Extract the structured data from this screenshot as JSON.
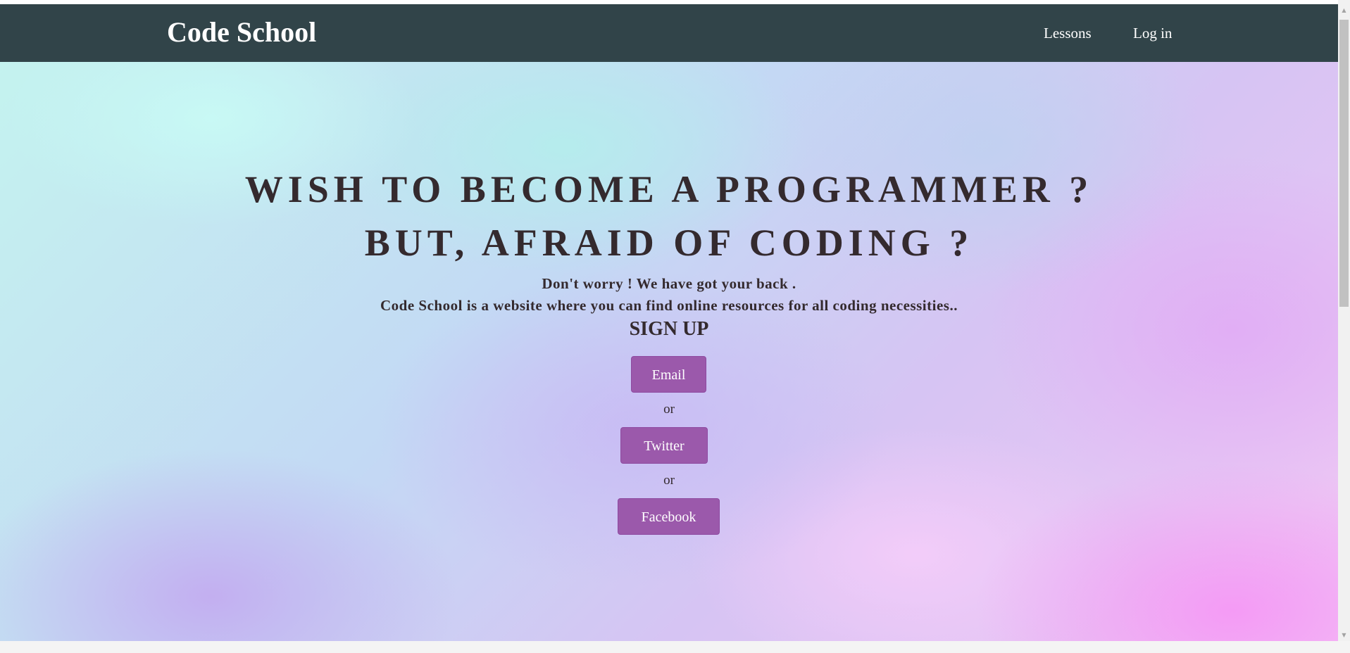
{
  "navbar": {
    "brand": "Code School",
    "links": [
      {
        "label": "Lessons"
      },
      {
        "label": "Log in"
      }
    ]
  },
  "hero": {
    "headline_line1": "WISH TO BECOME A PROGRAMMER ?",
    "headline_line2": "BUT, AFRAID OF CODING ?",
    "subtext_line1": "Don't worry ! We have got your back .",
    "subtext_line2": "Code School is a website where you can find online resources for all coding necessities..",
    "signup_title": "SIGN UP",
    "buttons": {
      "email": "Email",
      "twitter": "Twitter",
      "facebook": "Facebook"
    },
    "separator": "or"
  },
  "colors": {
    "navbar_bg": "#314449",
    "button_bg": "#9b59ab",
    "text_dark": "#342a2e"
  },
  "icons": {
    "scroll_up": "scroll-up-arrow-icon",
    "scroll_down": "scroll-down-arrow-icon"
  }
}
